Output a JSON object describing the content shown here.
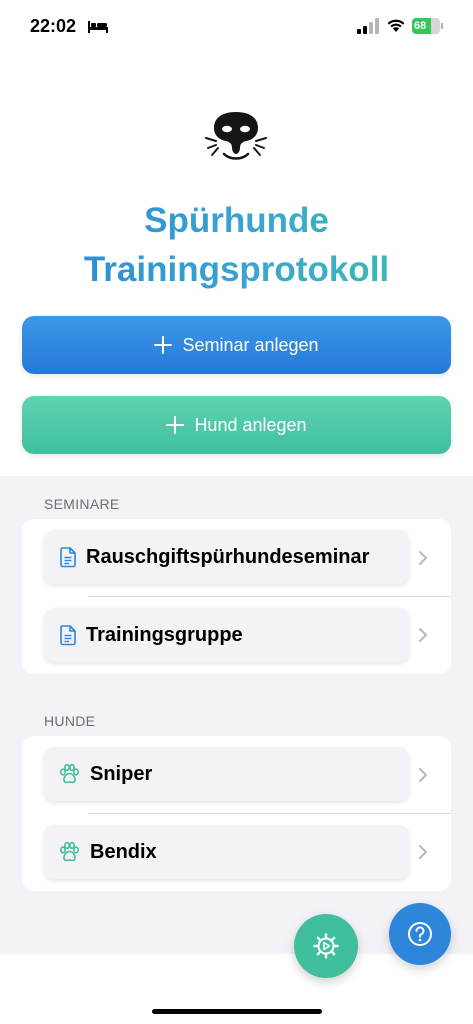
{
  "status_bar": {
    "time": "22:02",
    "battery": "68",
    "battery_level": 0.68
  },
  "app": {
    "title_line1": "Spürhunde",
    "title_line2": "Trainingsprotokoll",
    "accent_blue": "#2a86d6",
    "accent_green": "#3fbf9c"
  },
  "actions": {
    "seminar_label": "Seminar anlegen",
    "hund_label": "Hund anlegen"
  },
  "seminare": {
    "header": "SEMINARE",
    "items": [
      {
        "label": "Rauschgiftspürhundeseminar",
        "icon": "document-icon"
      },
      {
        "label": "Trainingsgruppe",
        "icon": "document-icon"
      }
    ]
  },
  "hunde": {
    "header": "HUNDE",
    "items": [
      {
        "label": "Sniper",
        "icon": "paw-icon"
      },
      {
        "label": "Bendix",
        "icon": "paw-icon"
      }
    ]
  },
  "fabs": {
    "settings_icon": "gear-icon",
    "help_icon": "question-icon"
  }
}
